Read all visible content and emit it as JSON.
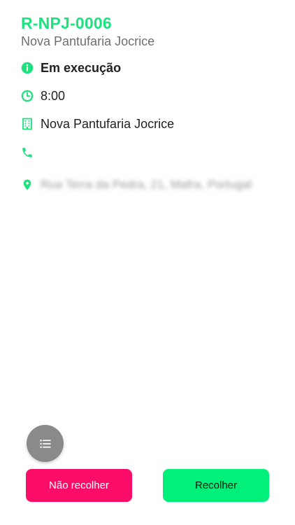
{
  "order": {
    "code": "R-NPJ-0006",
    "subtitle": "Nova Pantufaria Jocrice"
  },
  "details": {
    "status": "Em execução",
    "time": "8:00",
    "client": "Nova Pantufaria Jocrice",
    "phone": "",
    "address": "Rua Terra da Pedra, 21, Mafra, Portugal"
  },
  "icons": {
    "status": "info-icon",
    "time": "clock-icon",
    "client": "building-icon",
    "phone": "phone-icon",
    "address": "map-pin-icon",
    "fab": "list-icon"
  },
  "actions": {
    "reject_label": "Não recolher",
    "accept_label": "Recolher"
  },
  "colors": {
    "accent": "#1de27e",
    "reject": "#fc0d67",
    "accept": "#00f07a",
    "fab": "#8a8a8a"
  }
}
